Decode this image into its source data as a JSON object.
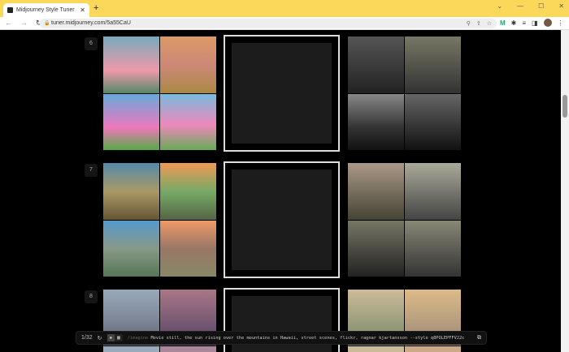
{
  "browser": {
    "tab_title": "Midjourney Style Tuner",
    "url": "tuner.midjourney.com/5a55CaU"
  },
  "rows": [
    {
      "number": "6"
    },
    {
      "number": "7"
    },
    {
      "number": "8"
    }
  ],
  "prompt_bar": {
    "page": "1/32",
    "prefix": "/imagine",
    "prompt": "Movie still, the sun rising over the mountains in Hawaii, street scenes, flickr, ragnar kjartansson --style q8POLEPFFVJ2c"
  }
}
